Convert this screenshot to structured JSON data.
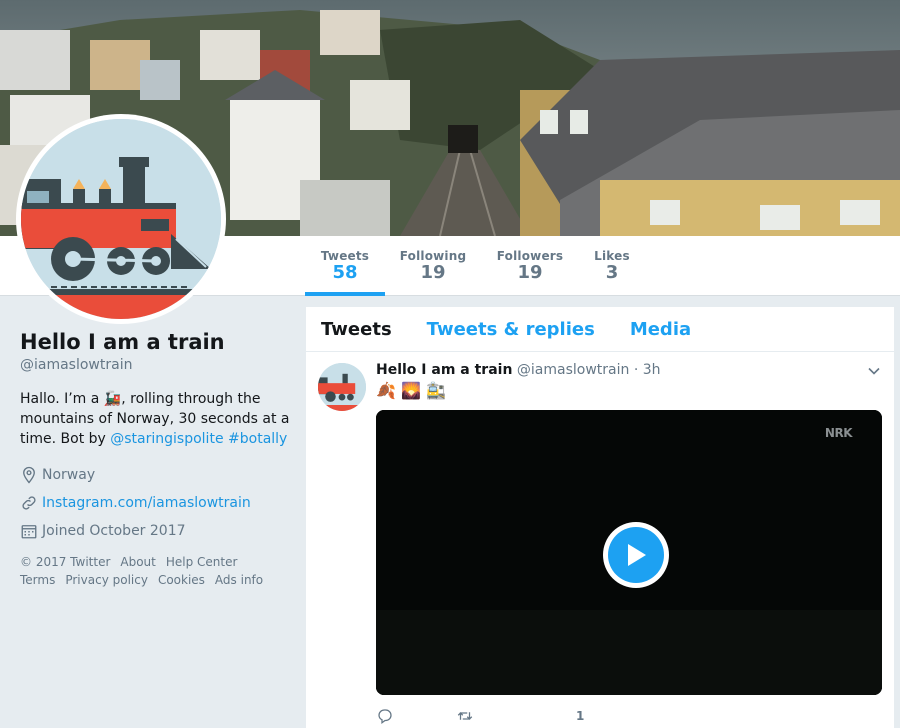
{
  "profile": {
    "name": "Hello I am a train",
    "handle": "@iamaslowtrain",
    "bio_part1": "Hallo. I’m a 🚂, rolling through the mountains of Norway, 30 seconds at a time. Bot by ",
    "bio_mention": "@staringispolite",
    "bio_hashtag": "#botally",
    "location": "Norway",
    "website": "Instagram.com/iamaslowtrain",
    "joined": "Joined October 2017"
  },
  "stats": [
    {
      "label": "Tweets",
      "value": "58"
    },
    {
      "label": "Following",
      "value": "19"
    },
    {
      "label": "Followers",
      "value": "19"
    },
    {
      "label": "Likes",
      "value": "3"
    }
  ],
  "footer": {
    "copyright": "© 2017 Twitter",
    "about": "About",
    "help": "Help Center",
    "terms": "Terms",
    "privacy": "Privacy policy",
    "cookies": "Cookies",
    "ads": "Ads info"
  },
  "tabs": {
    "tweets": "Tweets",
    "replies": "Tweets & replies",
    "media": "Media"
  },
  "tweet": {
    "name": "Hello I am a train",
    "handle": "@iamaslowtrain",
    "sep": " · ",
    "time": "3h",
    "text": "🍂 🌄 🚉",
    "watermark": "NRK",
    "like_count": "1"
  },
  "colors": {
    "accent": "#1da1f2",
    "link": "#1b95e0",
    "muted": "#657786",
    "background": "#e6ecf0"
  },
  "icons": {
    "location": "location-pin-icon",
    "website": "link-icon",
    "joined": "calendar-icon",
    "caret": "chevron-down-icon",
    "play": "play-icon",
    "reply": "reply-icon",
    "retweet": "retweet-icon",
    "like": "heart-icon"
  }
}
